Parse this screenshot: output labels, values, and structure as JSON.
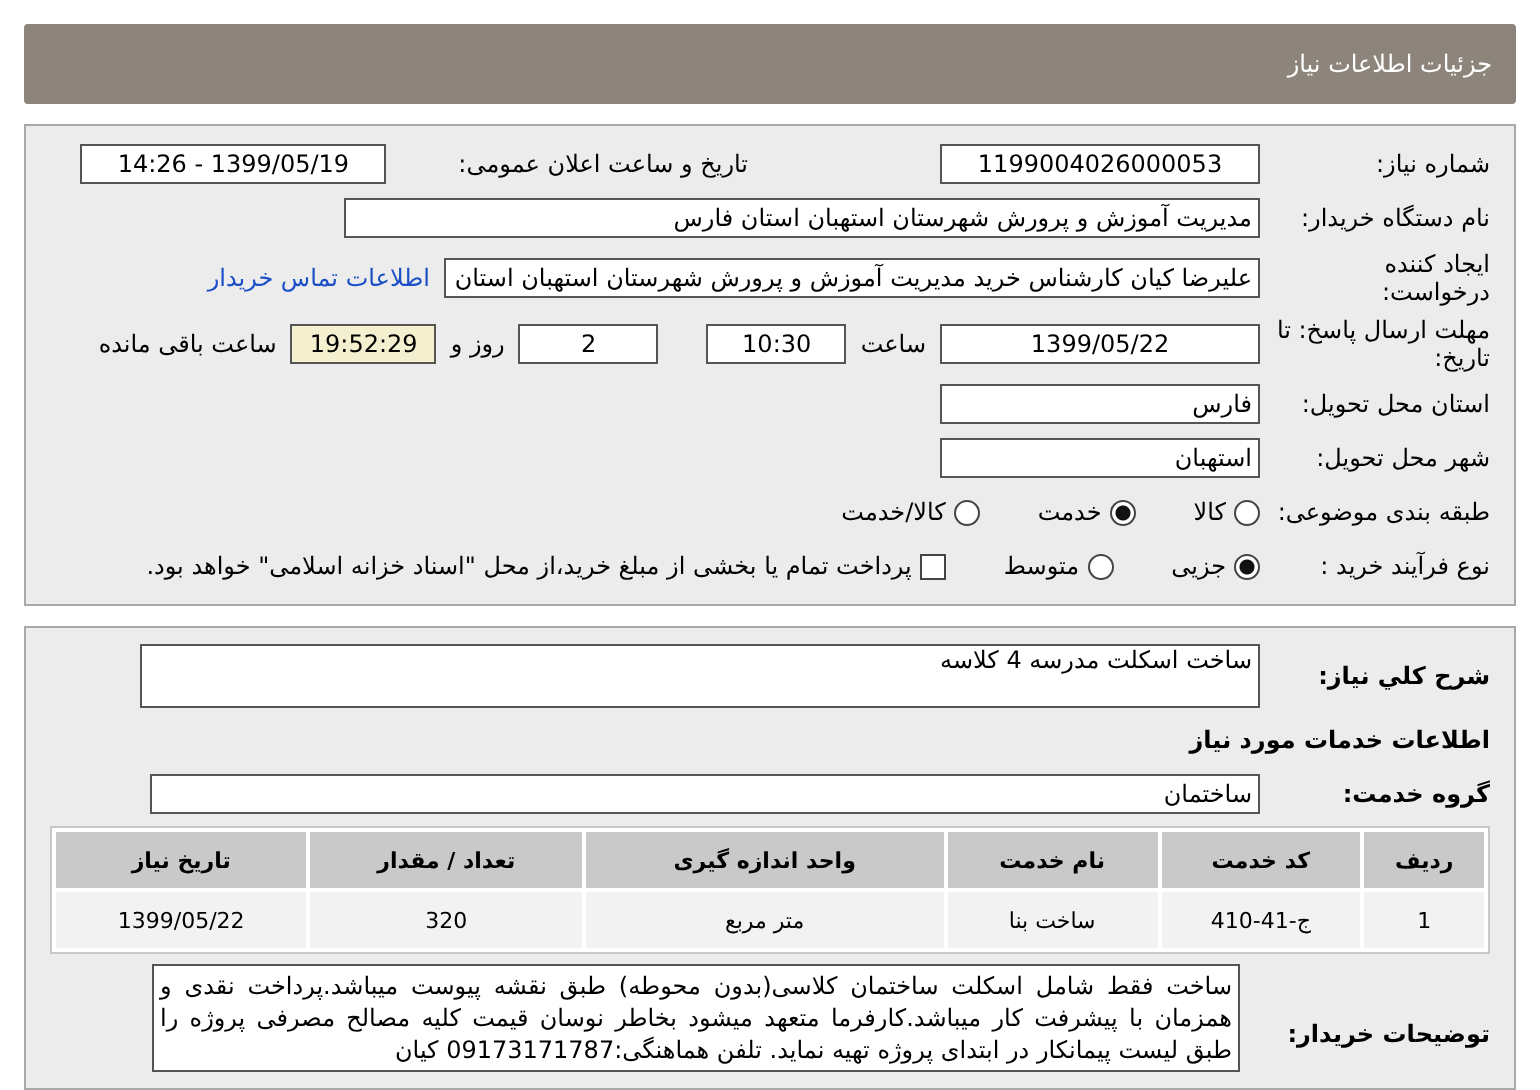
{
  "title": "جزئیات اطلاعات نیاز",
  "need_number": {
    "label": "شماره نیاز:",
    "value": "1199004026000053"
  },
  "announce": {
    "label": "تاریخ و ساعت اعلان عمومی:",
    "value": "1399/05/19 - 14:26"
  },
  "buyer": {
    "label": "نام دستگاه خریدار:",
    "value": "مدیریت آموزش و پرورش شهرستان استهبان استان فارس"
  },
  "creator": {
    "label": "ایجاد کننده درخواست:",
    "value": "علیرضا کیان کارشناس خرید مدیریت آموزش و پرورش شهرستان استهبان استان",
    "link": "اطلاعات تماس خریدار"
  },
  "deadline": {
    "label": "مهلت ارسال پاسخ: تا تاریخ:",
    "date": "1399/05/22",
    "time_label": "ساعت",
    "time": "10:30",
    "days": "2",
    "days_label": "روز و",
    "remaining": "19:52:29",
    "remaining_label": "ساعت باقی مانده"
  },
  "province": {
    "label": "استان محل تحویل:",
    "value": "فارس"
  },
  "city": {
    "label": "شهر محل تحویل:",
    "value": "استهبان"
  },
  "category": {
    "label": "طبقه بندی موضوعی:",
    "options": [
      {
        "label": "کالا",
        "selected": false
      },
      {
        "label": "خدمت",
        "selected": true
      },
      {
        "label": "کالا/خدمت",
        "selected": false
      }
    ]
  },
  "process": {
    "label": "نوع فرآیند خرید :",
    "options": [
      {
        "label": "جزیی",
        "selected": true
      },
      {
        "label": "متوسط",
        "selected": false
      }
    ],
    "treasury": {
      "label": "پرداخت تمام یا بخشی از مبلغ خرید،از محل \"اسناد خزانه اسلامی\" خواهد بود.",
      "checked": false
    }
  },
  "summary": {
    "label": "شرح کلي نیاز:",
    "value": "ساخت اسکلت مدرسه 4 کلاسه"
  },
  "services_heading": "اطلاعات خدمات مورد نیاز",
  "service_group": {
    "label": "گروه خدمت:",
    "value": "ساختمان"
  },
  "table": {
    "columns": [
      "ردیف",
      "کد خدمت",
      "نام خدمت",
      "واحد اندازه گیری",
      "تعداد / مقدار",
      "تاریخ نیاز"
    ],
    "rows": [
      [
        "1",
        "ج-41-410",
        "ساخت بنا",
        "متر مربع",
        "320",
        "1399/05/22"
      ]
    ]
  },
  "buyer_notes": {
    "label": "توضیحات خریدار:",
    "value": "ساخت فقط شامل اسکلت ساختمان کلاسی(بدون محوطه) طبق نقشه پیوست میباشد.پرداخت نقدی و همزمان با پیشرفت کار میباشد.کارفرما متعهد میشود بخاطر نوسان قیمت کلیه مصالح مصرفی پروژه را طبق لیست پیمانکار در ابتدای پروژه تهیه نماید. تلفن هماهنگی:09173171787 کیان"
  }
}
